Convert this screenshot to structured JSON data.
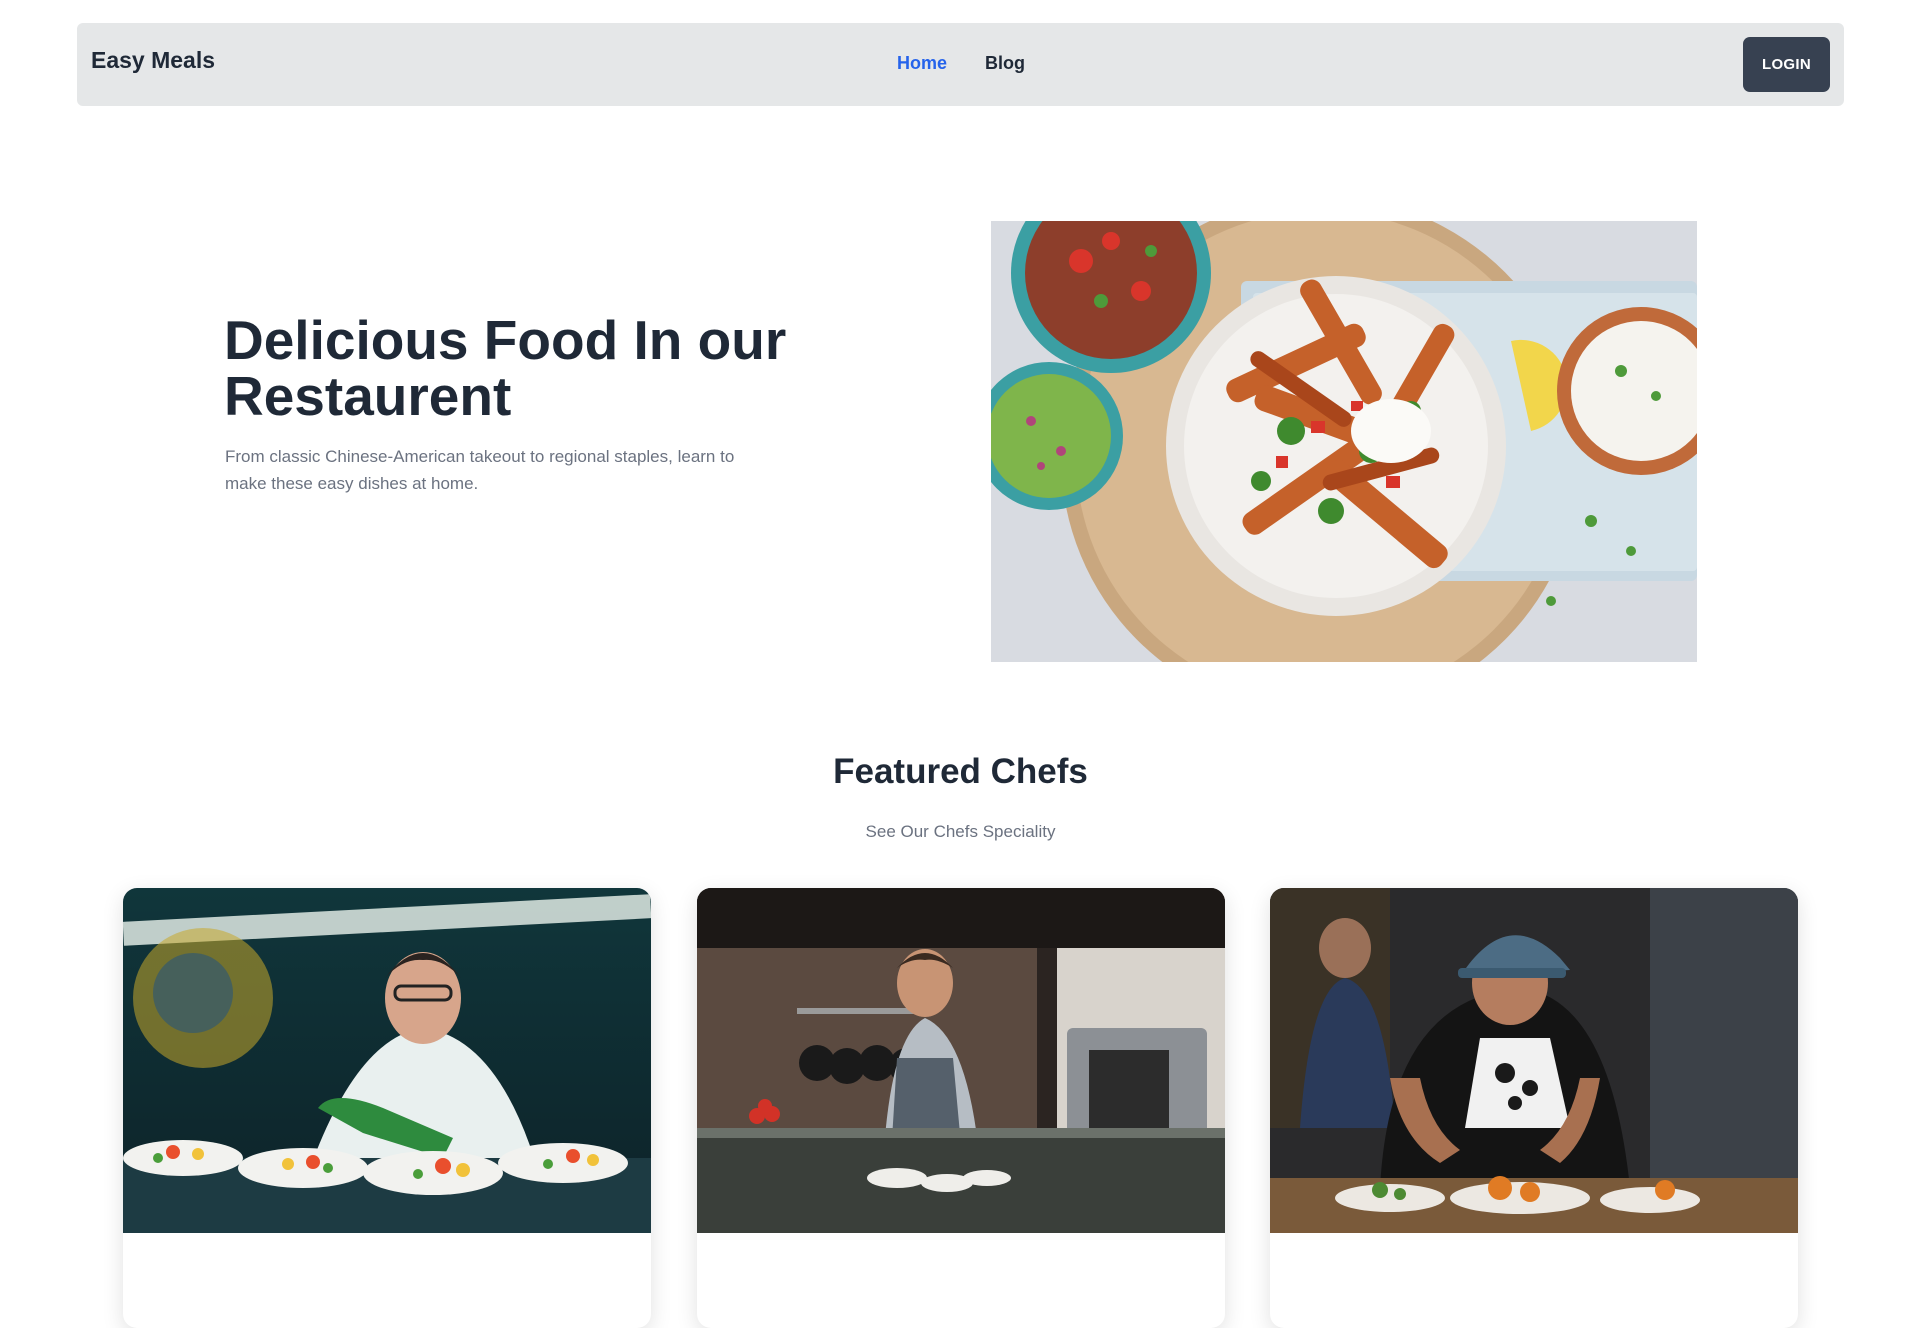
{
  "nav": {
    "brand": "Easy Meals",
    "links": [
      {
        "label": "Home",
        "active": true
      },
      {
        "label": "Blog",
        "active": false
      }
    ],
    "login_label": "LOGIN"
  },
  "hero": {
    "title": "Delicious Food In our Restaurent",
    "subtitle": "From classic Chinese-American takeout to regional staples, learn to make these easy dishes at home.",
    "image_icon": "food-platter-photo"
  },
  "featured": {
    "title": "Featured Chefs",
    "subtitle": "See Our Chefs Speciality",
    "chefs": [
      {
        "image_icon": "chef-plating-photo"
      },
      {
        "image_icon": "chef-kitchen-photo"
      },
      {
        "image_icon": "chef-cap-cooking-photo"
      }
    ]
  },
  "colors": {
    "accent": "#2563eb",
    "navbar_bg": "#e5e7e8",
    "button_bg": "#374151",
    "heading": "#1f2937",
    "muted": "#6b7280"
  }
}
